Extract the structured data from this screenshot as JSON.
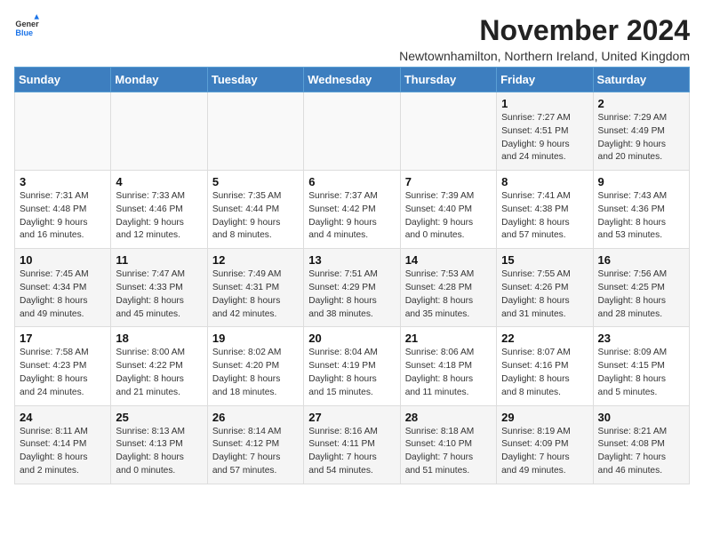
{
  "logo": {
    "general": "General",
    "blue": "Blue"
  },
  "title": "November 2024",
  "subtitle": "Newtownhamilton, Northern Ireland, United Kingdom",
  "days_of_week": [
    "Sunday",
    "Monday",
    "Tuesday",
    "Wednesday",
    "Thursday",
    "Friday",
    "Saturday"
  ],
  "weeks": [
    [
      {
        "day": "",
        "content": ""
      },
      {
        "day": "",
        "content": ""
      },
      {
        "day": "",
        "content": ""
      },
      {
        "day": "",
        "content": ""
      },
      {
        "day": "",
        "content": ""
      },
      {
        "day": "1",
        "content": "Sunrise: 7:27 AM\nSunset: 4:51 PM\nDaylight: 9 hours\nand 24 minutes."
      },
      {
        "day": "2",
        "content": "Sunrise: 7:29 AM\nSunset: 4:49 PM\nDaylight: 9 hours\nand 20 minutes."
      }
    ],
    [
      {
        "day": "3",
        "content": "Sunrise: 7:31 AM\nSunset: 4:48 PM\nDaylight: 9 hours\nand 16 minutes."
      },
      {
        "day": "4",
        "content": "Sunrise: 7:33 AM\nSunset: 4:46 PM\nDaylight: 9 hours\nand 12 minutes."
      },
      {
        "day": "5",
        "content": "Sunrise: 7:35 AM\nSunset: 4:44 PM\nDaylight: 9 hours\nand 8 minutes."
      },
      {
        "day": "6",
        "content": "Sunrise: 7:37 AM\nSunset: 4:42 PM\nDaylight: 9 hours\nand 4 minutes."
      },
      {
        "day": "7",
        "content": "Sunrise: 7:39 AM\nSunset: 4:40 PM\nDaylight: 9 hours\nand 0 minutes."
      },
      {
        "day": "8",
        "content": "Sunrise: 7:41 AM\nSunset: 4:38 PM\nDaylight: 8 hours\nand 57 minutes."
      },
      {
        "day": "9",
        "content": "Sunrise: 7:43 AM\nSunset: 4:36 PM\nDaylight: 8 hours\nand 53 minutes."
      }
    ],
    [
      {
        "day": "10",
        "content": "Sunrise: 7:45 AM\nSunset: 4:34 PM\nDaylight: 8 hours\nand 49 minutes."
      },
      {
        "day": "11",
        "content": "Sunrise: 7:47 AM\nSunset: 4:33 PM\nDaylight: 8 hours\nand 45 minutes."
      },
      {
        "day": "12",
        "content": "Sunrise: 7:49 AM\nSunset: 4:31 PM\nDaylight: 8 hours\nand 42 minutes."
      },
      {
        "day": "13",
        "content": "Sunrise: 7:51 AM\nSunset: 4:29 PM\nDaylight: 8 hours\nand 38 minutes."
      },
      {
        "day": "14",
        "content": "Sunrise: 7:53 AM\nSunset: 4:28 PM\nDaylight: 8 hours\nand 35 minutes."
      },
      {
        "day": "15",
        "content": "Sunrise: 7:55 AM\nSunset: 4:26 PM\nDaylight: 8 hours\nand 31 minutes."
      },
      {
        "day": "16",
        "content": "Sunrise: 7:56 AM\nSunset: 4:25 PM\nDaylight: 8 hours\nand 28 minutes."
      }
    ],
    [
      {
        "day": "17",
        "content": "Sunrise: 7:58 AM\nSunset: 4:23 PM\nDaylight: 8 hours\nand 24 minutes."
      },
      {
        "day": "18",
        "content": "Sunrise: 8:00 AM\nSunset: 4:22 PM\nDaylight: 8 hours\nand 21 minutes."
      },
      {
        "day": "19",
        "content": "Sunrise: 8:02 AM\nSunset: 4:20 PM\nDaylight: 8 hours\nand 18 minutes."
      },
      {
        "day": "20",
        "content": "Sunrise: 8:04 AM\nSunset: 4:19 PM\nDaylight: 8 hours\nand 15 minutes."
      },
      {
        "day": "21",
        "content": "Sunrise: 8:06 AM\nSunset: 4:18 PM\nDaylight: 8 hours\nand 11 minutes."
      },
      {
        "day": "22",
        "content": "Sunrise: 8:07 AM\nSunset: 4:16 PM\nDaylight: 8 hours\nand 8 minutes."
      },
      {
        "day": "23",
        "content": "Sunrise: 8:09 AM\nSunset: 4:15 PM\nDaylight: 8 hours\nand 5 minutes."
      }
    ],
    [
      {
        "day": "24",
        "content": "Sunrise: 8:11 AM\nSunset: 4:14 PM\nDaylight: 8 hours\nand 2 minutes."
      },
      {
        "day": "25",
        "content": "Sunrise: 8:13 AM\nSunset: 4:13 PM\nDaylight: 8 hours\nand 0 minutes."
      },
      {
        "day": "26",
        "content": "Sunrise: 8:14 AM\nSunset: 4:12 PM\nDaylight: 7 hours\nand 57 minutes."
      },
      {
        "day": "27",
        "content": "Sunrise: 8:16 AM\nSunset: 4:11 PM\nDaylight: 7 hours\nand 54 minutes."
      },
      {
        "day": "28",
        "content": "Sunrise: 8:18 AM\nSunset: 4:10 PM\nDaylight: 7 hours\nand 51 minutes."
      },
      {
        "day": "29",
        "content": "Sunrise: 8:19 AM\nSunset: 4:09 PM\nDaylight: 7 hours\nand 49 minutes."
      },
      {
        "day": "30",
        "content": "Sunrise: 8:21 AM\nSunset: 4:08 PM\nDaylight: 7 hours\nand 46 minutes."
      }
    ]
  ],
  "colors": {
    "header_bg": "#3d7ebf",
    "header_text": "#ffffff",
    "odd_row": "#f5f5f5",
    "even_row": "#ffffff"
  }
}
